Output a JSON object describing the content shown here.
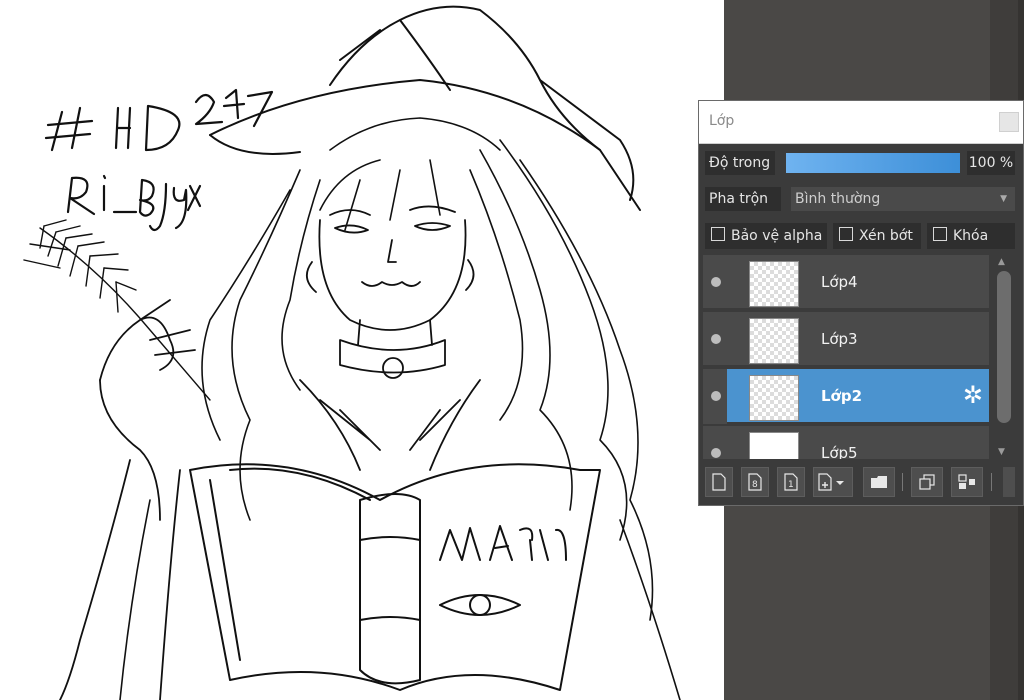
{
  "canvas": {
    "handwritten_text": [
      "# HD 247",
      "Ri_Bjyx"
    ],
    "book_title": "MAGic"
  },
  "layer_panel": {
    "title": "Lớp",
    "opacity_label": "Độ trong",
    "opacity_value": "100 %",
    "opacity_fraction": 1.0,
    "blend_label": "Pha trộn",
    "blend_mode": "Bình thường",
    "checkboxes": {
      "protect_alpha": "Bảo vệ alpha",
      "clipping": "Xén bớt",
      "lock": "Khóa"
    },
    "layers": [
      {
        "name": "Lớp4",
        "selected": false
      },
      {
        "name": "Lớp3",
        "selected": false
      },
      {
        "name": "Lớp2",
        "selected": true
      },
      {
        "name": "Lớp5",
        "selected": false
      }
    ],
    "accent_color": "#4b93cf"
  }
}
